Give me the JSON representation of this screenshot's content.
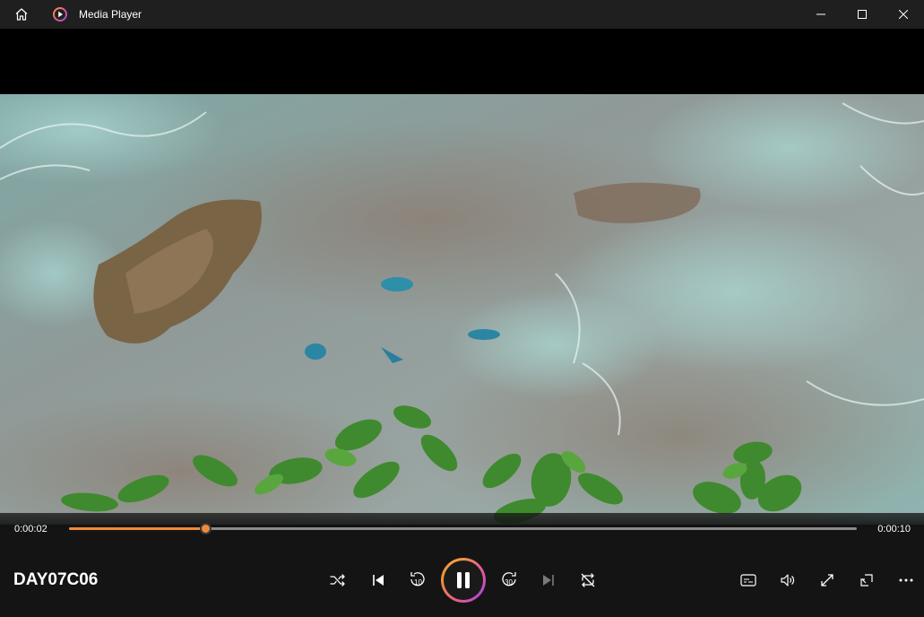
{
  "window": {
    "title": "Media Player",
    "icons": {
      "home": "home-icon",
      "app": "media-player-icon",
      "minimize": "minimize-icon",
      "maximize": "maximize-icon",
      "close": "close-icon"
    }
  },
  "player": {
    "media_title": "DAY07C06",
    "elapsed": "0:00:02",
    "remaining": "0:00:10",
    "progress_fraction": 0.173,
    "accent_color": "#f08a3a",
    "state": "playing"
  },
  "controls": {
    "icons": {
      "shuffle": "shuffle-icon",
      "previous": "previous-icon",
      "skip_back": "skip-back-10-icon",
      "play_pause": "pause-icon",
      "skip_forward": "skip-forward-30-icon",
      "next": "next-icon",
      "repeat": "repeat-off-icon",
      "captions": "captions-icon",
      "volume": "volume-icon",
      "fullscreen": "fullscreen-icon",
      "mini_player": "mini-player-icon",
      "more": "more-options-icon"
    },
    "skip_back_seconds": "10",
    "skip_forward_seconds": "30"
  }
}
